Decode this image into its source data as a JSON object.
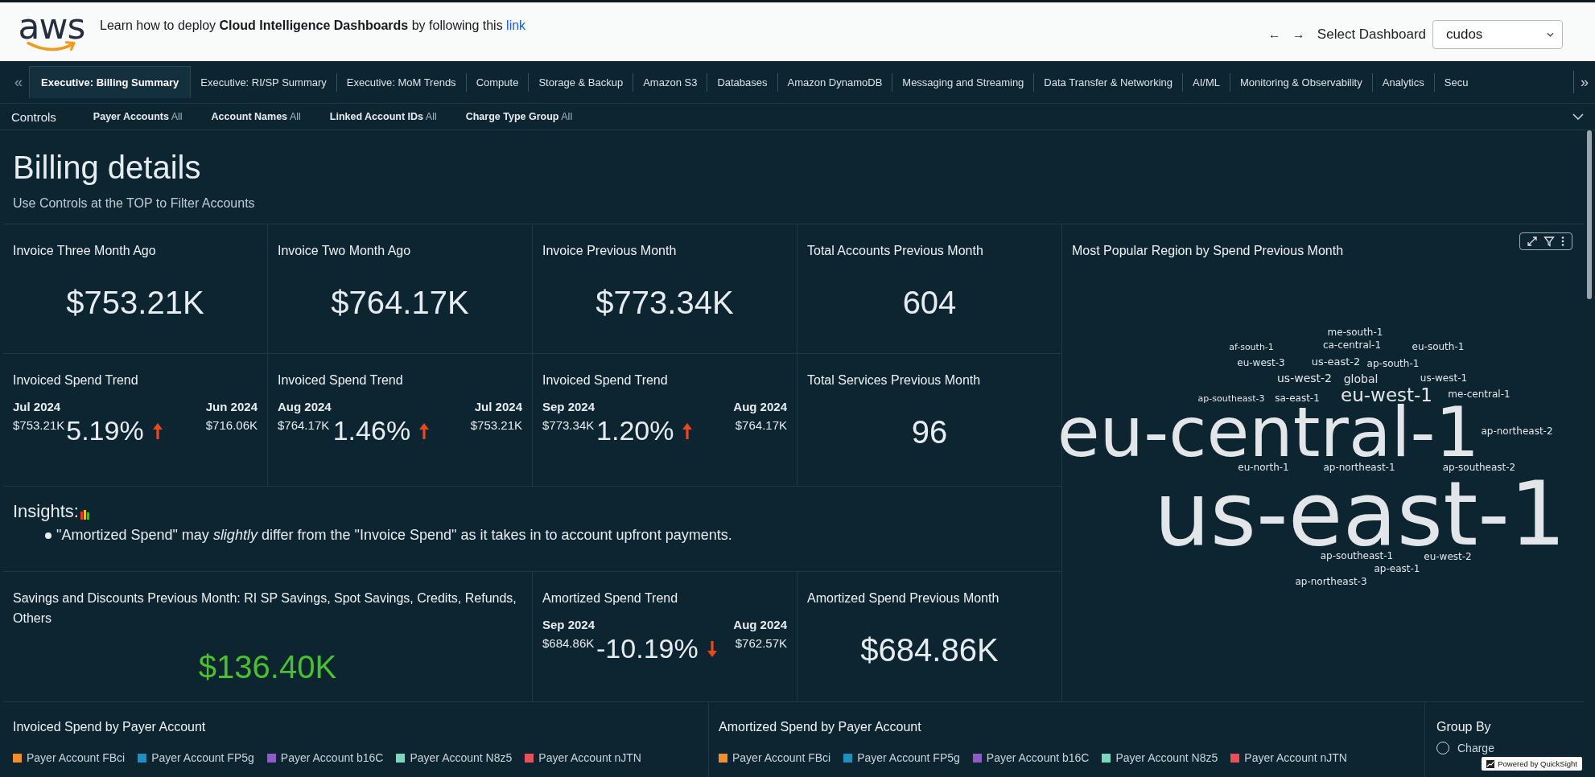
{
  "header": {
    "logo_text": "aws",
    "banner": "Learn how to deploy **Cloud Intelligence Dashboards** by following this",
    "banner_link": "link",
    "back": "←",
    "forward": "→",
    "select_label": "Select Dashboard",
    "select_value": "cudos"
  },
  "tabs": {
    "prev": "«",
    "next": "»",
    "items": [
      {
        "label": "Executive: Billing Summary",
        "selected": true
      },
      {
        "label": "Executive: RI/SP Summary",
        "selected": false
      },
      {
        "label": "Executive: MoM Trends",
        "selected": false
      },
      {
        "label": "Compute",
        "selected": false
      },
      {
        "label": "Storage & Backup",
        "selected": false
      },
      {
        "label": "Amazon S3",
        "selected": false
      },
      {
        "label": "Databases",
        "selected": false
      },
      {
        "label": "Amazon DynamoDB",
        "selected": false
      },
      {
        "label": "Messaging and Streaming",
        "selected": false
      },
      {
        "label": "Data Transfer & Networking",
        "selected": false
      },
      {
        "label": "AI/ML",
        "selected": false
      },
      {
        "label": "Monitoring & Observability",
        "selected": false
      },
      {
        "label": "Analytics",
        "selected": false
      },
      {
        "label": "Secu",
        "selected": false
      }
    ]
  },
  "controls": {
    "label": "Controls",
    "filters": [
      {
        "name": "Payer Accounts",
        "value": "All"
      },
      {
        "name": "Account Names",
        "value": "All"
      },
      {
        "name": "Linked Account IDs",
        "value": "All"
      },
      {
        "name": "Charge Type Group",
        "value": "All"
      }
    ]
  },
  "page": {
    "title": "Billing details",
    "subtitle": "Use Controls at the TOP to Filter Accounts"
  },
  "kpis": [
    {
      "kind": "metric",
      "title": "Invoice Three Month Ago",
      "value": "$753.21K",
      "highlight": false
    },
    {
      "kind": "metric",
      "title": "Invoice Two Month Ago",
      "value": "$764.17K",
      "highlight": false
    },
    {
      "kind": "metric",
      "title": "Invoice Previous Month",
      "value": "$773.34K",
      "highlight": false
    },
    {
      "kind": "metric",
      "title": "Total Accounts Previous Month",
      "value": "604",
      "highlight": false
    },
    {
      "kind": "trend",
      "title": "Invoiced Spend Trend",
      "current_period": "Jul 2024",
      "current_value": "$753.21K",
      "change": "5.19%",
      "rising": true,
      "previous_period": "Jun 2024",
      "previous_value": "$716.06K"
    },
    {
      "kind": "trend",
      "title": "Invoiced Spend Trend",
      "current_period": "Aug 2024",
      "current_value": "$764.17K",
      "change": "1.46%",
      "rising": true,
      "previous_period": "Jul 2024",
      "previous_value": "$753.21K"
    },
    {
      "kind": "trend",
      "title": "Invoiced Spend Trend",
      "current_period": "Sep 2024",
      "current_value": "$773.34K",
      "change": "1.20%",
      "rising": true,
      "previous_period": "Aug 2024",
      "previous_value": "$764.17K"
    },
    {
      "kind": "metric",
      "title": "Total Services Previous Month",
      "value": "96",
      "highlight": false
    }
  ],
  "insights": {
    "title": "Insights:",
    "bullets": [
      "\"Amortized Spend\" may *slightly* differ from the \"Invoice Spend\" as it takes in to account upfront payments."
    ]
  },
  "kpis_2": [
    {
      "kind": "metric",
      "title": "Savings and Discounts Previous Month: RI SP Savings, Spot Savings, Credits, Refunds, Others",
      "value": "$136.40K",
      "highlight": true
    },
    {
      "kind": "trend",
      "title": "Amortized Spend Trend",
      "current_period": "Sep 2024",
      "current_value": "$684.86K",
      "change": "-10.19%",
      "rising": false,
      "previous_period": "Aug 2024",
      "previous_value": "$762.57K"
    },
    {
      "kind": "metric",
      "title": "Amortized Spend Previous Month",
      "value": "$684.86K",
      "highlight": false
    }
  ],
  "word_cloud": {
    "title": "Most Popular Region by Spend Previous Month",
    "words": [
      "me-south-1",
      "af-south-1",
      "ca-central-1",
      "eu-south-1",
      "eu-west-3",
      "us-east-2",
      "ap-south-1",
      "us-west-2",
      "global",
      "us-west-1",
      "ap-southeast-3",
      "sa-east-1",
      "eu-west-1",
      "me-central-1",
      "eu-central-1",
      "ap-northeast-2",
      "eu-north-1",
      "ap-northeast-1",
      "ap-southeast-2",
      "us-east-1",
      "ap-southeast-1",
      "eu-west-2",
      "ap-east-1",
      "ap-northeast-3"
    ]
  },
  "bottom_charts": [
    {
      "title": "Invoiced Spend by Payer Account",
      "legend": [
        {
          "label": "Payer Account FBci",
          "color": "#f28e2b"
        },
        {
          "label": "Payer Account FP5g",
          "color": "#1f8fbf"
        },
        {
          "label": "Payer Account b16C",
          "color": "#8e5bc7"
        },
        {
          "label": "Payer Account N8z5",
          "color": "#7ed6bd"
        },
        {
          "label": "Payer Account nJTN",
          "color": "#e8505b"
        }
      ]
    },
    {
      "title": "Amortized Spend by Payer Account",
      "legend": [
        {
          "label": "Payer Account FBci",
          "color": "#f28e2b"
        },
        {
          "label": "Payer Account FP5g",
          "color": "#1f8fbf"
        },
        {
          "label": "Payer Account b16C",
          "color": "#8e5bc7"
        },
        {
          "label": "Payer Account N8z5",
          "color": "#7ed6bd"
        },
        {
          "label": "Payer Account nJTN",
          "color": "#e8505b"
        }
      ]
    }
  ],
  "group_by": {
    "title": "Group By",
    "options": [
      {
        "label": "Charge",
        "selected": false
      }
    ]
  },
  "badge": "Powered by QuickSight"
}
